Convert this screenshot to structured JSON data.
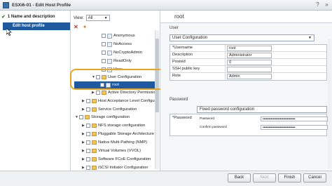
{
  "window": {
    "title": "ESXi6-01 - Edit Host Profile"
  },
  "nav": {
    "step1": "1 Name and description",
    "step2": "Edit host profile"
  },
  "tree": {
    "view_label": "View:",
    "view_value": "All",
    "nodes": [
      {
        "label": "Anonymous"
      },
      {
        "label": "NoAccess"
      },
      {
        "label": "NoCryptoAdmin"
      },
      {
        "label": "ReadOnly"
      },
      {
        "label": "View"
      },
      {
        "label": "User Configuration"
      },
      {
        "label": "root"
      },
      {
        "label": "Active Directory Permission"
      },
      {
        "label": "Host Acceptance Level Configur"
      },
      {
        "label": "Service Configuration"
      },
      {
        "label": "Storage configuration"
      },
      {
        "label": "NFS storage configuration"
      },
      {
        "label": "Pluggable Storage Architecture (P"
      },
      {
        "label": "Native Multi-Pathing (NMP)"
      },
      {
        "label": "Virtual Volumes (VVOL)"
      },
      {
        "label": "Software FCoE Configuration"
      },
      {
        "label": "iSCSI Initiator Configuration"
      }
    ]
  },
  "detail": {
    "breadcrumb": "root",
    "user_section": "User",
    "user_dropdown": "User Configuration",
    "fields": [
      {
        "label": "*Username",
        "value": "root"
      },
      {
        "label": "Description",
        "value": "Administrator"
      },
      {
        "label": "Posixid",
        "value": "0"
      },
      {
        "label": "SSH public key",
        "value": ""
      },
      {
        "label": "Role",
        "value": "Admin"
      }
    ],
    "password_section": "Password",
    "password_dropdown": "Fixed password configuration",
    "password_label": "*Password",
    "password_field_label": "Password",
    "confirm_field_label": "Confirm password",
    "password_mask": "••••••••••••••••••••••••••••••••",
    "confirm_mask": "••••••••••••••••••••••••••••••••"
  },
  "footer": {
    "back": "Back",
    "next": "Next",
    "finish": "Finish",
    "cancel": "Cancel"
  }
}
